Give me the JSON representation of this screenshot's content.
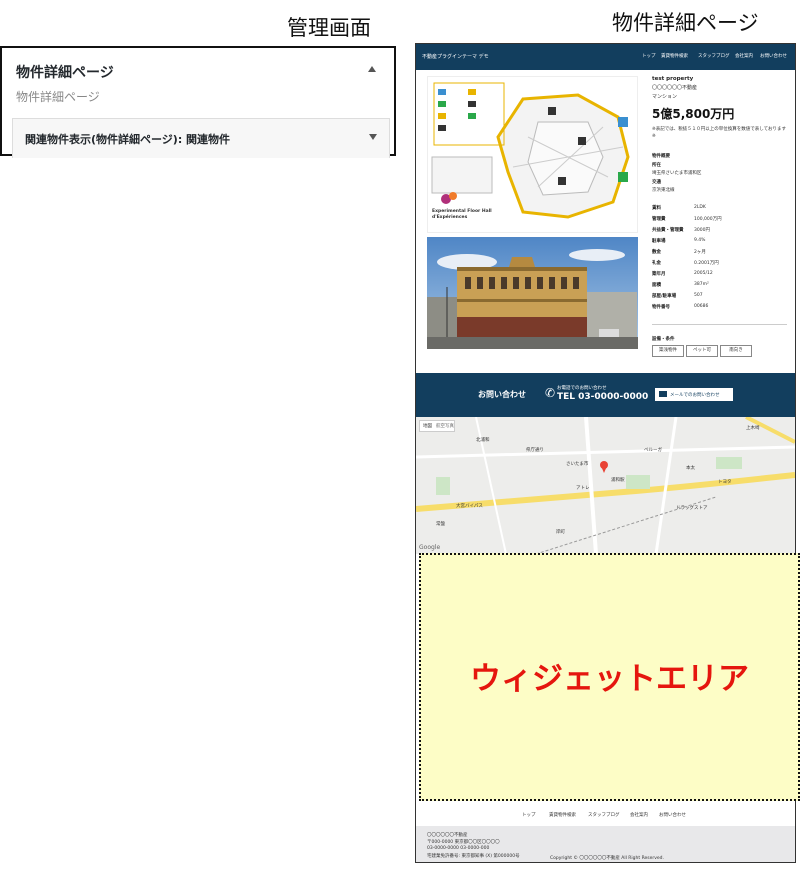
{
  "captions": {
    "admin": "管理画面",
    "detail": "物件詳細ページ"
  },
  "admin": {
    "title": "物件詳細ページ",
    "subtitle": "物件詳細ページ",
    "dropdown_label": "関連物件表示(物件詳細ページ): 関連物件"
  },
  "site": {
    "header_logo": "不動産プラグインテーマ デモ",
    "nav": [
      "トップ",
      "賃貸物件検索",
      "スタッフブログ",
      "会社案内",
      "お問い合わせ"
    ],
    "property": {
      "name": "test property",
      "company": "〇〇〇〇〇〇不動産",
      "type": "マンション",
      "price": "5億5,800万円",
      "note": "※表記では、税抜５１０円以上の単位換算を数値で表しております※",
      "section_label": "物件概要",
      "location_label": "所在",
      "location_value": "埼玉県さいたま市浦和区",
      "traffic_label": "交通",
      "traffic_value": "京浜東北線",
      "specs": [
        {
          "label": "賃料",
          "value": "2LDK"
        },
        {
          "label": "管理費",
          "value": "100,000万円"
        },
        {
          "label": "共益費・管理費",
          "value": "3000円"
        },
        {
          "label": "駐車場",
          "value": "9.4%"
        },
        {
          "label": "敷金",
          "value": "2ヶ月"
        },
        {
          "label": "礼金",
          "value": "0.2001万円"
        },
        {
          "label": "築年月",
          "value": "2005/12"
        },
        {
          "label": "面積",
          "value": "387m²"
        },
        {
          "label": "部屋/駐車場",
          "value": "507"
        },
        {
          "label": "物件番号",
          "value": "00686"
        }
      ],
      "facilities_label": "設備・条件",
      "facilities": [
        "築浅物件",
        "ペット可",
        "南向き"
      ]
    },
    "contact": {
      "label": "お問い合わせ",
      "phone_caption": "お電話でのお問い合わせ",
      "phone": "TEL 03-0000-0000",
      "mail_button": "メールでのお問い合わせ"
    },
    "map": {
      "tab_map": "地図",
      "tab_sat": "航空写真",
      "google": "Google",
      "places": [
        "浦和駅",
        "ベルーガ",
        "さいたま市",
        "県庁通り",
        "アトレ",
        "本太",
        "北浦和",
        "大宮バイパス",
        "トヨタ",
        "ドラッグストア",
        "上木崎",
        "常盤",
        "岸町"
      ]
    },
    "image_caption": "Experimental Floor Hall d'Expériences",
    "footer_nav": [
      "トップ",
      "賃貸物件検索",
      "スタッフブログ",
      "会社案内",
      "お問い合わせ"
    ],
    "footer": {
      "company": "〇〇〇〇〇〇不動産",
      "address": "〒000-0000 東京都〇〇区〇〇〇〇",
      "tel": "03-0000-0000 03-0000-000",
      "license": "宅建業免許番号: 東京都知事 (X) 第000000号",
      "copyright": "Copyright © 〇〇〇〇〇〇不動産 All Right Reserved."
    }
  },
  "widget": {
    "label": "ウィジェットエリア"
  },
  "colors": {
    "header": "#123e5e",
    "widget_bg": "#fdfdc6",
    "widget_text": "#e5160e"
  }
}
